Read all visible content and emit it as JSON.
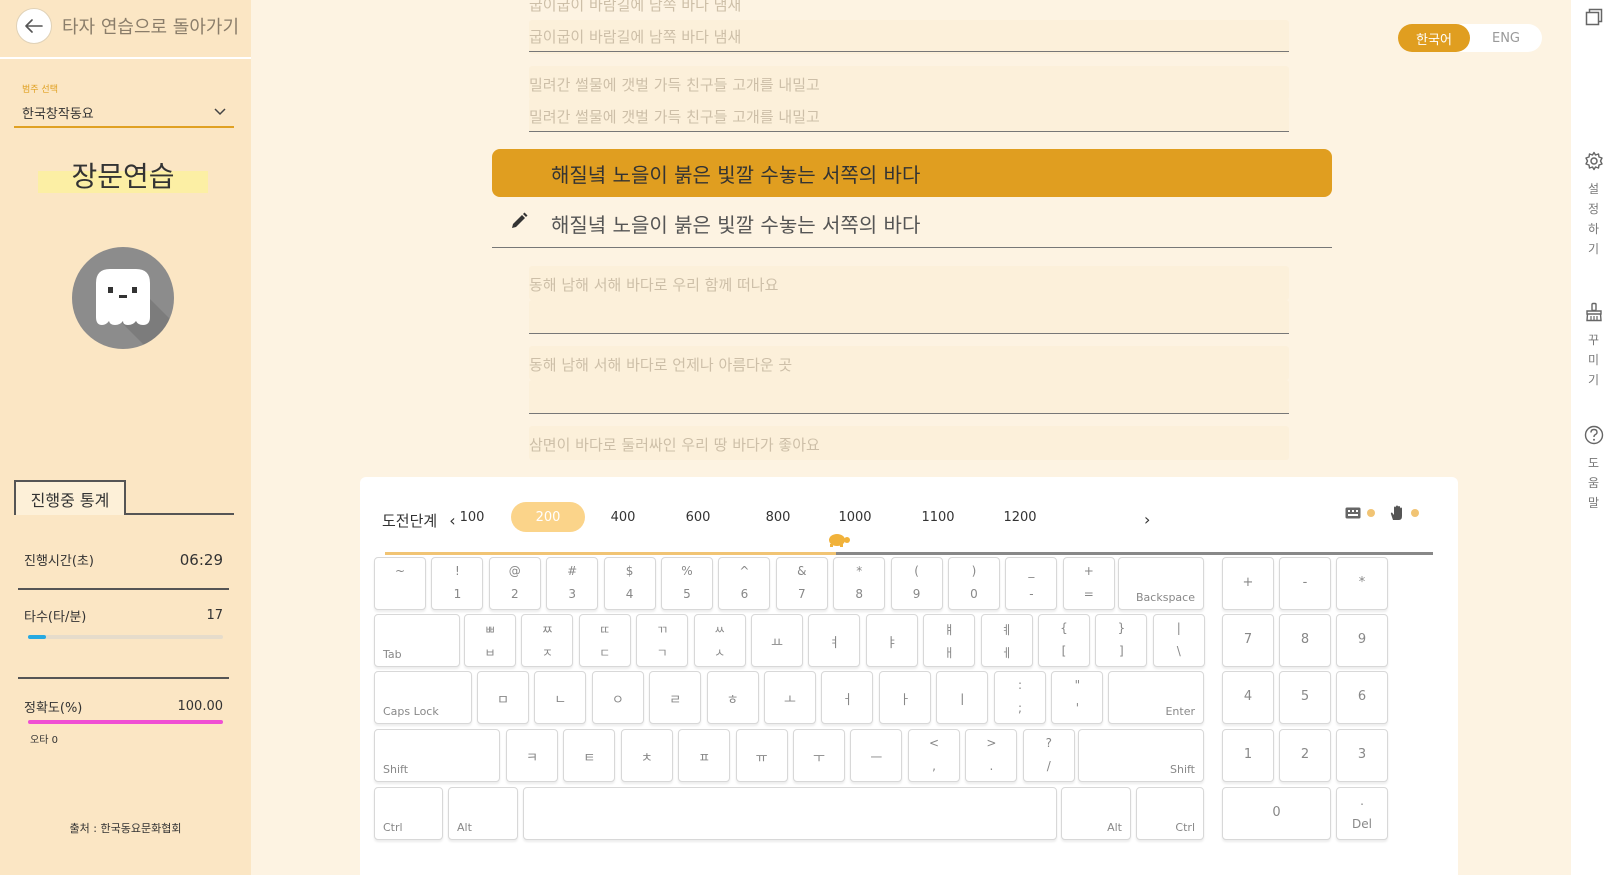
{
  "sidebar": {
    "back_label": "타자 연습으로 돌아가기",
    "category_label": "범주 선택",
    "category_value": "한국창작동요",
    "mode_title": "장문연습",
    "stats_tab": "진행중 통계",
    "stats": {
      "time_label": "진행시간(초)",
      "time_value": "06:29",
      "speed_label": "타수(타/분)",
      "speed_value": "17",
      "speed_progress": 0.09,
      "accuracy_label": "정확도(%)",
      "accuracy_value": "100.00",
      "accuracy_progress": 1.0,
      "error_label": "오타 0"
    },
    "source": "출처 : 한국동요문화협회",
    "colors": {
      "speed_bar": "#27a9e1",
      "accuracy_bar": "#f04fd3"
    }
  },
  "language": {
    "korean": "한국어",
    "english": "ENG",
    "selected": "korean"
  },
  "sentences": {
    "prev_2_a": "굽이굽이 바람길에 남쪽 바다 냄새",
    "prev_2_b": "굽이굽이 바람길에 남쪽 바다 냄새",
    "prev_1_a": "밀려간 썰물에 갯벌 가득 친구들 고개를 내밀고",
    "prev_1_b": "밀려간 썰물에 갯벌 가득 친구들 고개를 내밀고",
    "current": "해질녘 노을이 붉은 빛깔 수놓는 서쪽의 바다",
    "typed": "해질녘 노을이 붉은 빛깔 수놓는 서쪽의 바다",
    "next_1": "동해 남해 서해 바다로 우리 함께 떠나요",
    "next_2": "동해 남해 서해 바다로 언제나 아름다운 곳",
    "next_3": "삼면이 바다로 둘러싸인 우리 땅 바다가 좋아요"
  },
  "level": {
    "label": "도전단계",
    "options": [
      "100",
      "200",
      "400",
      "600",
      "800",
      "1000",
      "1100",
      "1200"
    ],
    "selected": "200",
    "progress": 0.43
  },
  "rail": {
    "settings": "설정하기",
    "decorate": "꾸미기",
    "help": "도움말"
  },
  "keyboard": {
    "row1": [
      {
        "top": "~",
        "bot": ""
      },
      {
        "top": "!",
        "bot": "1"
      },
      {
        "top": "@",
        "bot": "2"
      },
      {
        "top": "#",
        "bot": "3"
      },
      {
        "top": "$",
        "bot": "4"
      },
      {
        "top": "%",
        "bot": "5"
      },
      {
        "top": "^",
        "bot": "6"
      },
      {
        "top": "&",
        "bot": "7"
      },
      {
        "top": "*",
        "bot": "8"
      },
      {
        "top": "(",
        "bot": "9"
      },
      {
        "top": ")",
        "bot": "0"
      },
      {
        "top": "_",
        "bot": "-"
      },
      {
        "top": "+",
        "bot": "="
      }
    ],
    "backspace": "Backspace",
    "tab": "Tab",
    "row2": [
      {
        "top": "ㅃ",
        "bot": "ㅂ"
      },
      {
        "top": "ㅉ",
        "bot": "ㅈ"
      },
      {
        "top": "ㄸ",
        "bot": "ㄷ"
      },
      {
        "top": "ㄲ",
        "bot": "ㄱ"
      },
      {
        "top": "ㅆ",
        "bot": "ㅅ"
      },
      {
        "top": "",
        "bot": "",
        "mid": "ㅛ"
      },
      {
        "top": "",
        "bot": "",
        "mid": "ㅕ"
      },
      {
        "top": "",
        "bot": "",
        "mid": "ㅑ"
      },
      {
        "top": "ㅒ",
        "bot": "ㅐ"
      },
      {
        "top": "ㅖ",
        "bot": "ㅔ"
      },
      {
        "top": "{",
        "bot": "["
      },
      {
        "top": "}",
        "bot": "]"
      },
      {
        "top": "|",
        "bot": "\\"
      }
    ],
    "capslock": "Caps Lock",
    "row3": [
      "ㅁ",
      "ㄴ",
      "ㅇ",
      "ㄹ",
      "ㅎ",
      "ㅗ",
      "ㅓ",
      "ㅏ",
      "ㅣ"
    ],
    "row3_punct": [
      {
        "top": ":",
        "bot": ";"
      },
      {
        "top": "\"",
        "bot": "'"
      }
    ],
    "enter": "Enter",
    "shift": "Shift",
    "row4": [
      "ㅋ",
      "ㅌ",
      "ㅊ",
      "ㅍ",
      "ㅠ",
      "ㅜ",
      "ㅡ"
    ],
    "row4_punct": [
      {
        "top": "<",
        "bot": ","
      },
      {
        "top": ">",
        "bot": "."
      },
      {
        "top": "?",
        "bot": "/"
      }
    ],
    "ctrl": "Ctrl",
    "alt": "Alt",
    "numpad": {
      "ops": [
        "+",
        "-",
        "*"
      ],
      "r1": [
        "7",
        "8",
        "9"
      ],
      "r2": [
        "4",
        "5",
        "6"
      ],
      "r3": [
        "1",
        "2",
        "3"
      ],
      "zero": "0",
      "dot": ".",
      "del": "Del"
    }
  }
}
